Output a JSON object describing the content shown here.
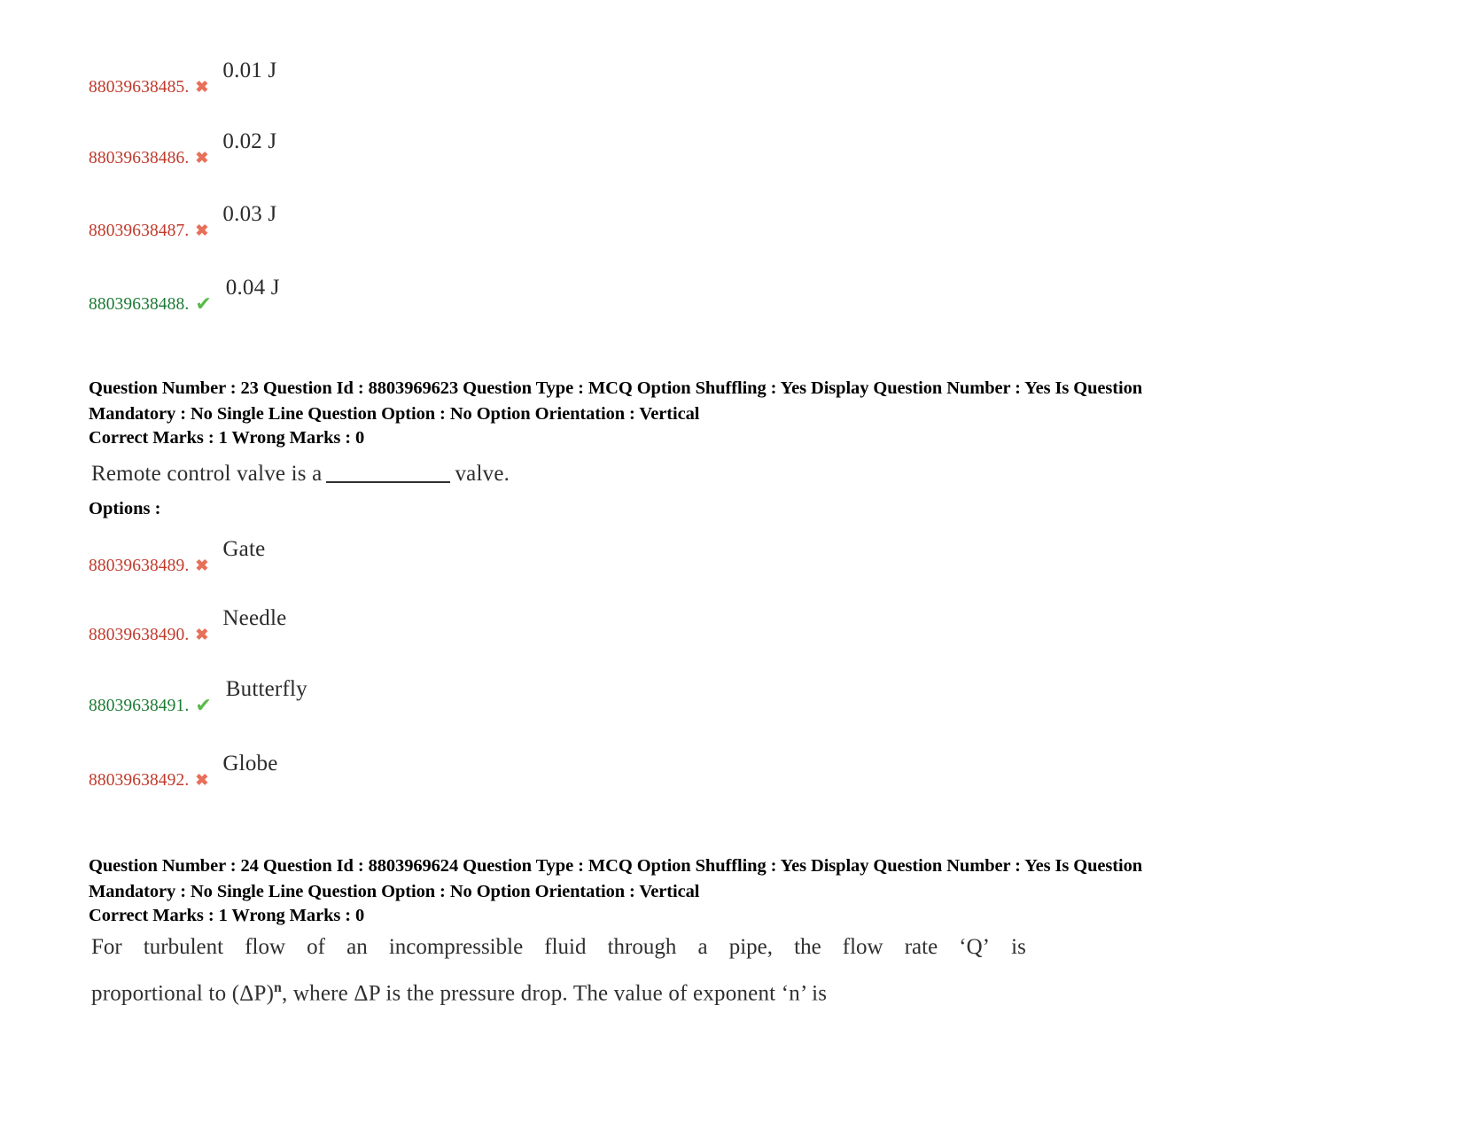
{
  "document": {
    "background": "#ffffff",
    "colors": {
      "wrong_id": "#c0392b",
      "correct_id": "#1b7a33",
      "cross_icon": "#e8705a",
      "check_icon": "#5aba4a",
      "body_text": "#2f2f2f",
      "meta_text": "#000000"
    },
    "icons": {
      "cross": "✖",
      "check": "✔",
      "cross_name": "wrong-answer-cross-icon",
      "check_name": "correct-answer-check-icon"
    }
  },
  "question_22_options": {
    "options": [
      {
        "id": "88039638485.",
        "status": "wrong",
        "text": "0.01 J"
      },
      {
        "id": "88039638486.",
        "status": "wrong",
        "text": "0.02 J"
      },
      {
        "id": "88039638487.",
        "status": "wrong",
        "text": "0.03 J"
      },
      {
        "id": "88039638488.",
        "status": "correct",
        "text": "0.04 J"
      }
    ]
  },
  "question_23": {
    "meta_line_1": "Question Number : 23 Question Id : 8803969623 Question Type : MCQ Option Shuffling : Yes Display Question Number : Yes Is Question",
    "meta_line_2": "Mandatory : No Single Line Question Option : No Option Orientation : Vertical",
    "marks_line": "Correct Marks : 1 Wrong Marks : 0",
    "question_number": "23",
    "question_id": "8803969623",
    "question_type": "MCQ",
    "option_shuffling": "Yes",
    "display_question_number": "Yes",
    "is_question_mandatory": "No",
    "single_line_question_option": "No",
    "option_orientation": "Vertical",
    "correct_marks": "1",
    "wrong_marks": "0",
    "body_before_blank": "Remote control valve is a",
    "body_after_blank": "valve.",
    "options_label": "Options :",
    "options": [
      {
        "id": "88039638489.",
        "status": "wrong",
        "text": "Gate"
      },
      {
        "id": "88039638490.",
        "status": "wrong",
        "text": "Needle"
      },
      {
        "id": "88039638491.",
        "status": "correct",
        "text": "Butterfly"
      },
      {
        "id": "88039638492.",
        "status": "wrong",
        "text": "Globe"
      }
    ]
  },
  "question_24": {
    "meta_line_1": "Question Number : 24 Question Id : 8803969624 Question Type : MCQ Option Shuffling : Yes Display Question Number : Yes Is Question",
    "meta_line_2": "Mandatory : No Single Line Question Option : No Option Orientation : Vertical",
    "marks_line": "Correct Marks : 1 Wrong Marks : 0",
    "question_number": "24",
    "question_id": "8803969624",
    "question_type": "MCQ",
    "option_shuffling": "Yes",
    "display_question_number": "Yes",
    "is_question_mandatory": "No",
    "single_line_question_option": "No",
    "option_orientation": "Vertical",
    "correct_marks": "1",
    "wrong_marks": "0",
    "body_line_1_words": [
      "For",
      "turbulent",
      "flow",
      "of",
      "an",
      "incompressible",
      "fluid",
      "through",
      "a",
      "pipe,",
      "the",
      "flow",
      "rate",
      "‘Q’",
      "is"
    ],
    "body_line_2_part_1": "proportional to (ΔP)",
    "body_line_2_exponent": "n",
    "body_line_2_part_2": ", where ΔP is the pressure drop. The value of exponent ‘n’ is"
  }
}
